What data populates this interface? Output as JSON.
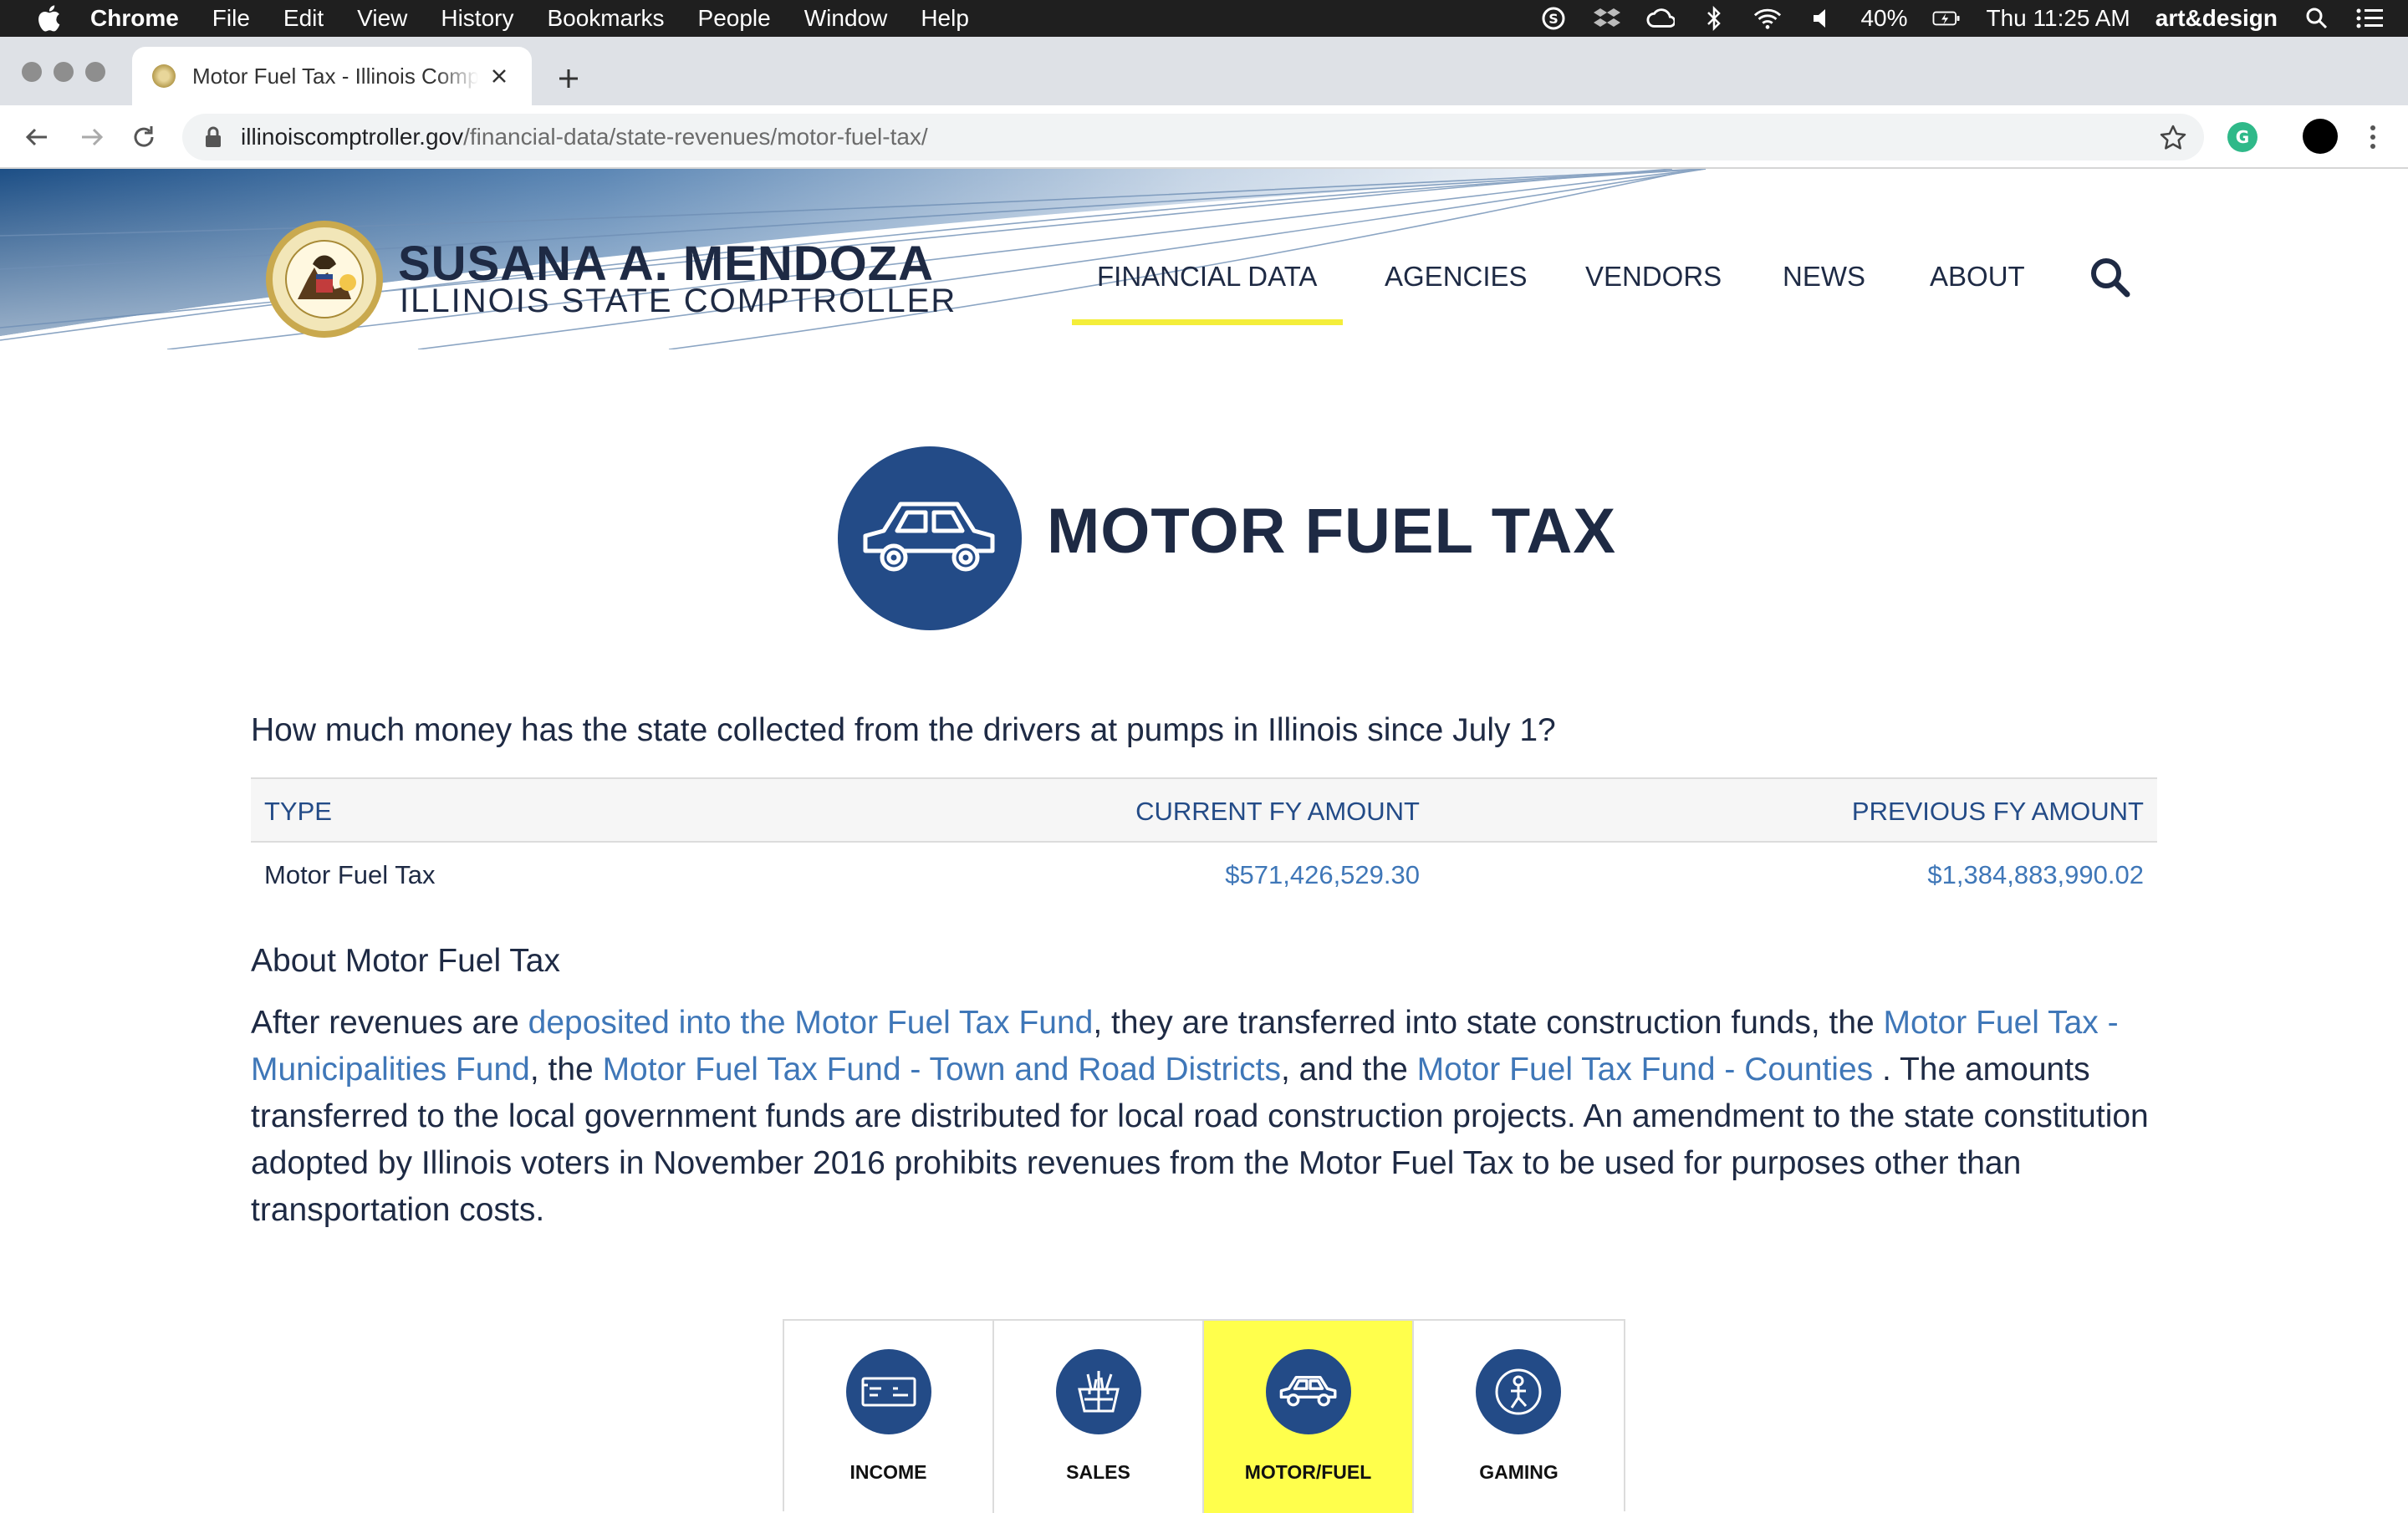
{
  "menubar": {
    "app": "Chrome",
    "items": [
      "File",
      "Edit",
      "View",
      "History",
      "Bookmarks",
      "People",
      "Window",
      "Help"
    ],
    "battery": "40%",
    "clock": "Thu 11:25 AM",
    "user": "art&design"
  },
  "browser": {
    "tab_title": "Motor Fuel Tax - Illinois Comptroller",
    "url_host": "illinoiscomptroller.gov",
    "url_path": "/financial-data/state-revenues/motor-fuel-tax/"
  },
  "site": {
    "brand_name": "SUSANA A. MENDOZA",
    "brand_sub": "ILLINOIS  STATE  COMPTROLLER",
    "nav": [
      "FINANCIAL DATA",
      "AGENCIES",
      "VENDORS",
      "NEWS",
      "ABOUT"
    ],
    "active_nav": "FINANCIAL DATA"
  },
  "page": {
    "title": "MOTOR FUEL TAX",
    "question": "How much money has the state collected from the drivers at pumps in Illinois since July 1?",
    "table": {
      "headers": [
        "TYPE",
        "CURRENT FY AMOUNT",
        "PREVIOUS FY AMOUNT"
      ],
      "rows": [
        {
          "type": "Motor Fuel Tax",
          "current": "$571,426,529.30",
          "previous": "$1,384,883,990.02"
        }
      ]
    },
    "about_title": "About Motor Fuel Tax",
    "about": {
      "t1": "After revenues are ",
      "l1": "deposited into the Motor Fuel Tax Fund",
      "t2": ", they are transferred into state construction funds, the ",
      "l2": "Motor Fuel Tax - Municipalities Fund",
      "t3": ", the ",
      "l3": "Motor Fuel Tax Fund - Town and Road Districts",
      "t4": ", and the ",
      "l4": "Motor Fuel Tax Fund - Counties",
      "t5": " . The amounts transferred to the local government funds are distributed for local road construction projects. An amendment to the state constitution adopted by Illinois voters in November 2016 prohibits revenues from the Motor Fuel Tax to be used for purposes other than transportation costs."
    },
    "tiles": [
      {
        "label": "INCOME",
        "icon": "paycheck-icon"
      },
      {
        "label": "SALES",
        "icon": "shopping-basket-icon"
      },
      {
        "label": "MOTOR/FUEL",
        "icon": "car-icon"
      },
      {
        "label": "GAMING",
        "icon": "gaming-icon"
      }
    ],
    "active_tile": "MOTOR/FUEL"
  },
  "colors": {
    "navy": "#1e2a44",
    "brand_blue": "#234b87",
    "link_blue": "#3f77b8",
    "nav_highlight": "#f4ee3a",
    "tile_active": "#ffff4c"
  }
}
